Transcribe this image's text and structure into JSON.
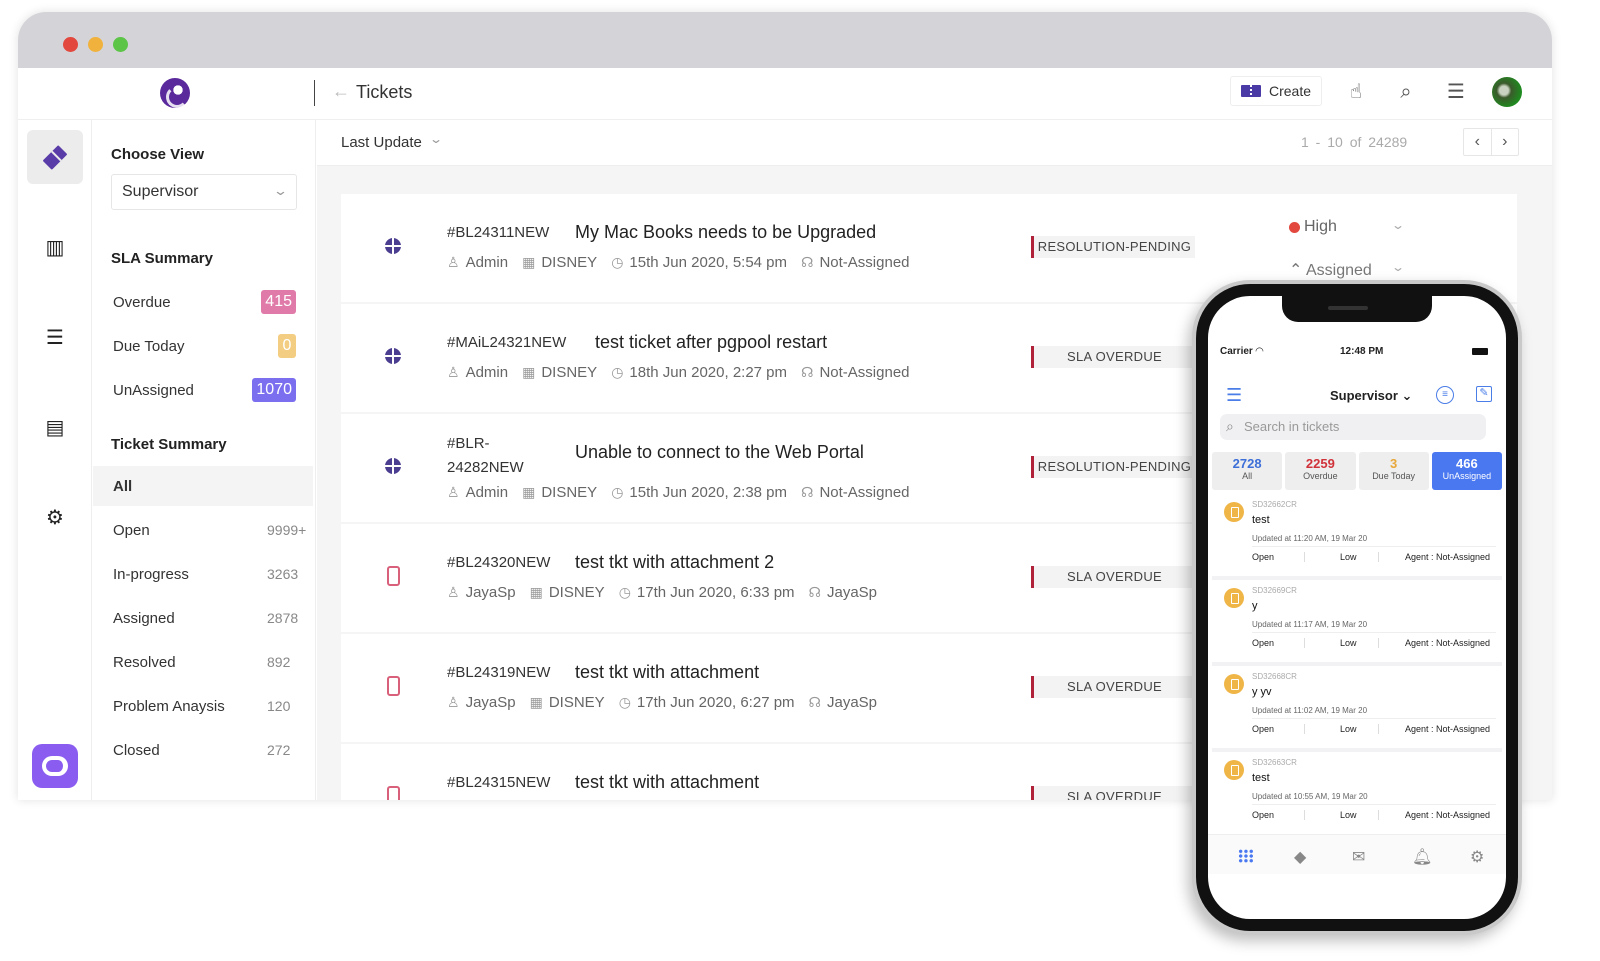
{
  "window": {
    "title": "Tickets"
  },
  "topbar": {
    "back_icon": "arrow-left-icon",
    "title": "Tickets",
    "create_label": "Create",
    "icons": [
      "touch-icon",
      "search-icon",
      "menu-icon",
      "user-avatar"
    ]
  },
  "rail": {
    "items": [
      {
        "name": "tickets",
        "icon": "ticket-icon",
        "active": true
      },
      {
        "name": "knowledge-base",
        "icon": "library-icon"
      },
      {
        "name": "list",
        "icon": "list-icon"
      },
      {
        "name": "reports",
        "icon": "report-icon"
      },
      {
        "name": "settings",
        "icon": "gear-icon"
      }
    ],
    "brand_icon": "brand-a-icon"
  },
  "filter": {
    "choose_view_label": "Choose View",
    "view_value": "Supervisor",
    "sla_title": "SLA Summary",
    "sla": [
      {
        "label": "Overdue",
        "count": "415",
        "color": "#e07aa8"
      },
      {
        "label": "Due Today",
        "count": "0",
        "color": "#f3cd82"
      },
      {
        "label": "UnAssigned",
        "count": "1070",
        "color": "#7b6ff0"
      }
    ],
    "ticket_summary_title": "Ticket Summary",
    "ticket_summary": [
      {
        "label": "All",
        "count": "",
        "active": true
      },
      {
        "label": "Open",
        "count": "9999+"
      },
      {
        "label": "In-progress",
        "count": "3263"
      },
      {
        "label": "Assigned",
        "count": "2878"
      },
      {
        "label": "Resolved",
        "count": "892"
      },
      {
        "label": "Problem Anaysis",
        "count": "120"
      },
      {
        "label": "Closed",
        "count": "272"
      }
    ]
  },
  "main": {
    "sort_label": "Last Update",
    "pager_text": "1 - 10  of  24289",
    "priority_label": "High",
    "assign_label": "Assigned",
    "tickets": [
      {
        "source": "web",
        "id": "#BL24311NEW",
        "subject": "My Mac Books needs to be Upgraded",
        "requester": "Admin",
        "org": "DISNEY",
        "date": "15th Jun 2020, 5:54 pm",
        "agent": "Not-Assigned",
        "status": "RESOLUTION-PENDING"
      },
      {
        "source": "web",
        "id": "#MAiL24321NEW",
        "subject": "test ticket after pgpool restart",
        "requester": "Admin",
        "org": "DISNEY",
        "date": "18th Jun 2020, 2:27 pm",
        "agent": "Not-Assigned",
        "status": "SLA OVERDUE"
      },
      {
        "source": "web",
        "id": "#BLR-24282NEW",
        "subject": "Unable to connect to the Web Portal",
        "requester": "Admin",
        "org": "DISNEY",
        "date": "15th Jun 2020, 2:38 pm",
        "agent": "Not-Assigned",
        "status": "RESOLUTION-PENDING"
      },
      {
        "source": "mobile",
        "id": "#BL24320NEW",
        "subject": "test tkt with attachment 2",
        "requester": "JayaSp",
        "org": "DISNEY",
        "date": "17th Jun 2020, 6:33 pm",
        "agent": "JayaSp",
        "status": "SLA OVERDUE"
      },
      {
        "source": "mobile",
        "id": "#BL24319NEW",
        "subject": "test tkt with attachment",
        "requester": "JayaSp",
        "org": "DISNEY",
        "date": "17th Jun 2020, 6:27 pm",
        "agent": "JayaSp",
        "status": "SLA OVERDUE"
      },
      {
        "source": "mobile",
        "id": "#BL24315NEW",
        "subject": "test tkt with attachment",
        "requester": "",
        "org": "",
        "date": "",
        "agent": "",
        "status": "SLA OVERDUE"
      }
    ]
  },
  "phone": {
    "carrier": "Carrier",
    "time": "12:48 PM",
    "view": "Supervisor",
    "search_placeholder": "Search in tickets",
    "tabs": [
      {
        "count": "2728",
        "label": "All",
        "color": "#3d6fd8"
      },
      {
        "count": "2259",
        "label": "Overdue",
        "color": "#d0323a"
      },
      {
        "count": "3",
        "label": "Due Today",
        "color": "#e8a73a"
      },
      {
        "count": "466",
        "label": "UnAssigned",
        "color": "#ffffff",
        "active": true
      }
    ],
    "tickets": [
      {
        "id": "SD32662CR",
        "subject": "test",
        "updated": "Updated at 11:20 AM, 19 Mar 20",
        "status": "Open",
        "priority": "Low",
        "agent": "Agent : Not-Assigned"
      },
      {
        "id": "SD32669CR",
        "subject": "y",
        "updated": "Updated at 11:17 AM, 19 Mar 20",
        "status": "Open",
        "priority": "Low",
        "agent": "Agent : Not-Assigned"
      },
      {
        "id": "SD32668CR",
        "subject": "y yv",
        "updated": "Updated at 11:02 AM, 19 Mar 20",
        "status": "Open",
        "priority": "Low",
        "agent": "Agent : Not-Assigned"
      },
      {
        "id": "SD32663CR",
        "subject": "test",
        "updated": "Updated at 10:55 AM, 19 Mar 20",
        "status": "Open",
        "priority": "Low",
        "agent": "Agent : Not-Assigned"
      }
    ],
    "nav": [
      "grid-icon",
      "ticket-icon",
      "mail-icon",
      "bell-icon",
      "gear-icon"
    ]
  }
}
